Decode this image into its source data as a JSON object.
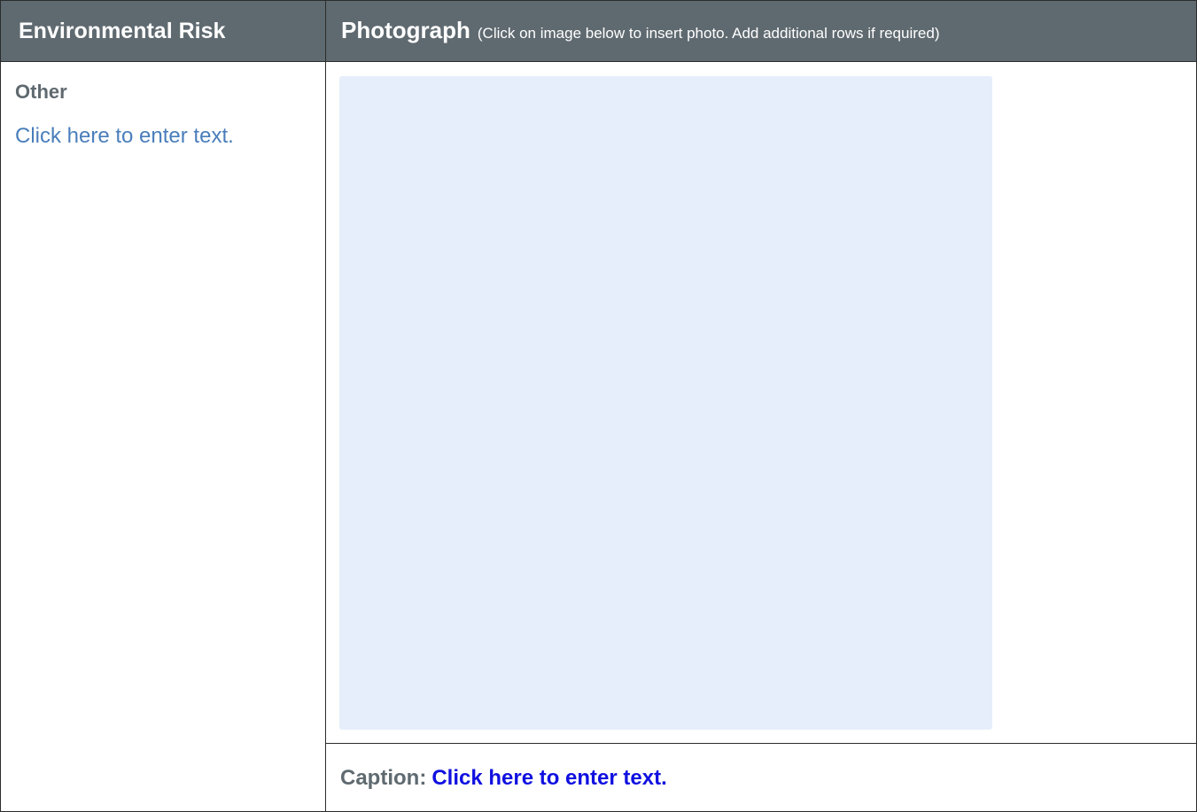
{
  "header": {
    "left_title": "Environmental Risk",
    "right_title": "Photograph",
    "right_note": "(Click on image below to insert photo. Add additional rows if required)"
  },
  "risk": {
    "label": "Other",
    "text_placeholder": "Click here to enter text."
  },
  "photo": {
    "placeholder_color": "#e6eefb"
  },
  "caption": {
    "label": "Caption:",
    "text_placeholder": "Click here to enter text."
  },
  "colors": {
    "header_bg": "#5f6a70",
    "header_text": "#ffffff",
    "label_gray": "#5f6a70",
    "placeholder_blue": "#4a7ebb",
    "caption_blue": "#1010e0"
  }
}
